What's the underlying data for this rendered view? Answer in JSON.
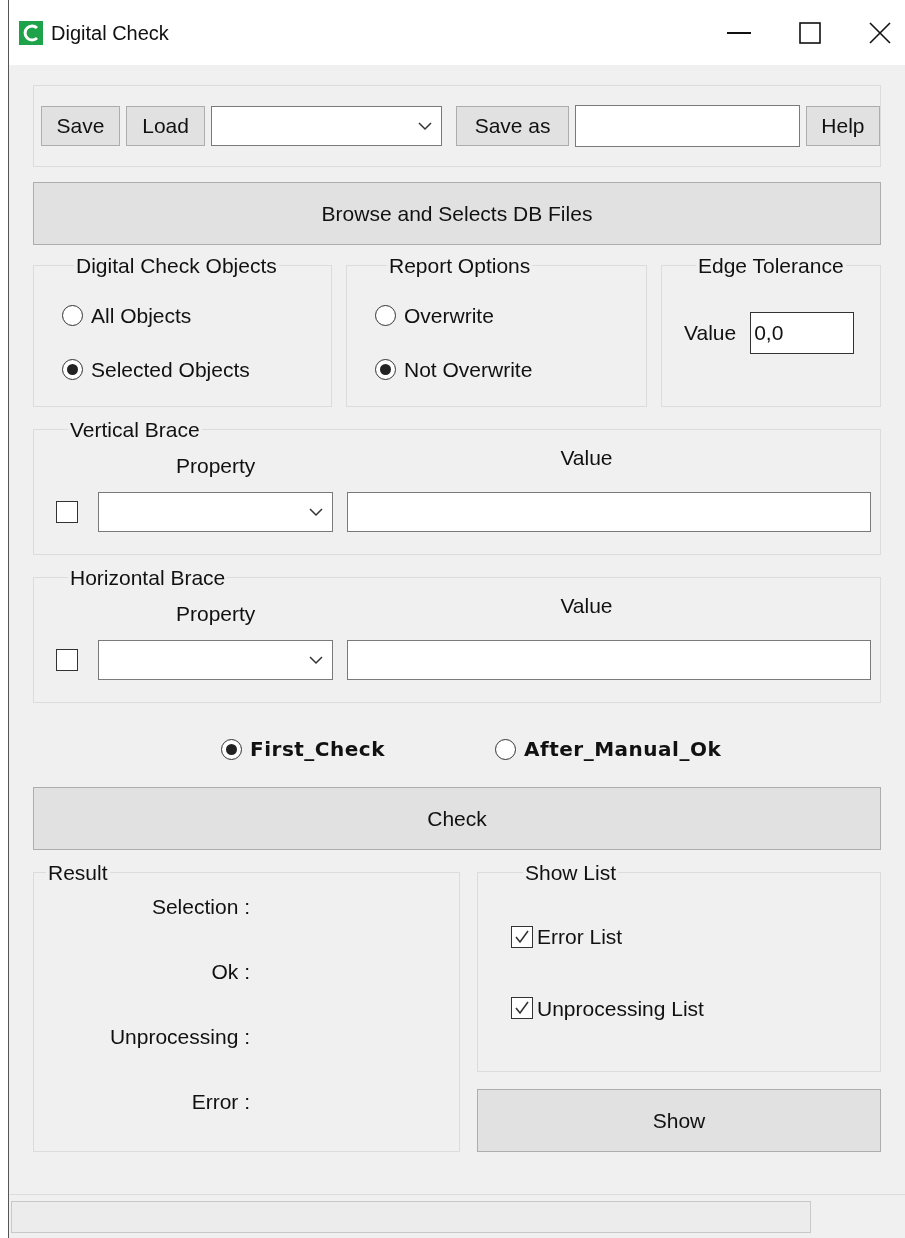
{
  "window": {
    "title": "Digital Check"
  },
  "toolbar": [
    {
      "kind": "button",
      "label": "Save"
    },
    {
      "kind": "button",
      "label": "Load"
    },
    {
      "kind": "dropdown"
    },
    {
      "kind": "button",
      "label": "Save as"
    },
    {
      "kind": "text_field"
    },
    {
      "kind": "button",
      "label": "Help"
    }
  ],
  "browse_button": "Browse and Selects DB Files",
  "digital_check_objects": {
    "title": "Digital Check Objects",
    "options": [
      {
        "label": "All Objects",
        "selected": false
      },
      {
        "label": "Selected Objects",
        "selected": true
      }
    ]
  },
  "report_options": {
    "title": "Report Options",
    "options": [
      {
        "label": "Overwrite",
        "selected": false
      },
      {
        "label": "Not Overwrite",
        "selected": true
      }
    ]
  },
  "edge_tolerance": {
    "title": "Edge Tolerance",
    "label": "Value",
    "value": "0,0"
  },
  "braces": [
    {
      "title": "Vertical Brace",
      "property_label": "Property",
      "value_label": "Value",
      "checked": false
    },
    {
      "title": "Horizontal Brace",
      "property_label": "Property",
      "value_label": "Value",
      "checked": false
    }
  ],
  "check_mode": [
    {
      "label": "First_Check",
      "selected": true
    },
    {
      "label": "After_Manual_Ok",
      "selected": false
    }
  ],
  "check_button": "Check",
  "result": {
    "title": "Result",
    "rows": [
      "Selection :",
      "Ok :",
      "Unprocessing :",
      "Error :"
    ]
  },
  "show_list": {
    "title": "Show List",
    "items": [
      {
        "label": "Error List",
        "checked": true
      },
      {
        "label": "Unprocessing List",
        "checked": true
      }
    ]
  },
  "show_button": "Show"
}
